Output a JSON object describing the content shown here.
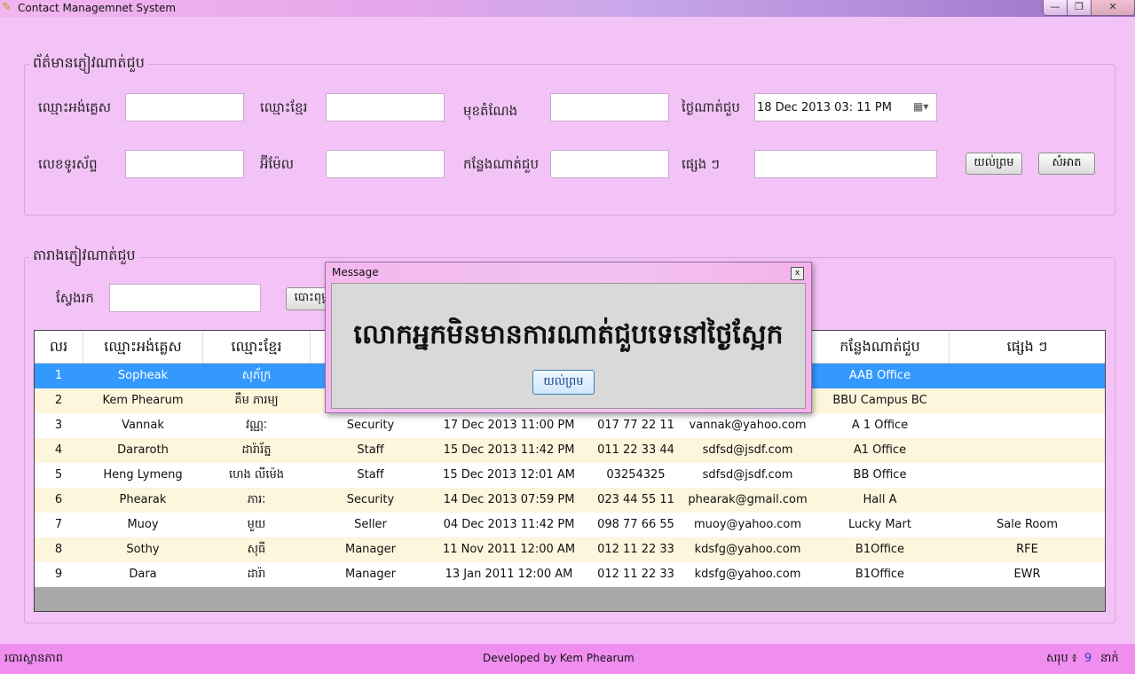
{
  "window": {
    "title": "Contact Managemnet System",
    "min": "—",
    "max": "❐",
    "close": "✕"
  },
  "info_group": {
    "legend": "ព័ត៌មានភ្ញៀវណាត់ជួប",
    "fields": {
      "english_name": {
        "label": "ឈ្មោះអង់គ្លេស",
        "value": ""
      },
      "khmer_name": {
        "label": "ឈ្មោះខ្មែរ",
        "value": ""
      },
      "position": {
        "label": "មុខតំណែង",
        "value": ""
      },
      "appointment_date": {
        "label": "ថ្ងៃណាត់ជួប",
        "value": "18 Dec 2013   03: 11 PM"
      },
      "phone": {
        "label": "លេខទូរស័ព្ទ",
        "value": ""
      },
      "email": {
        "label": "អ៊ីម៉ែល",
        "value": ""
      },
      "place": {
        "label": "កន្លែងណាត់ជួប",
        "value": ""
      },
      "other": {
        "label": "ផ្សេង ៗ",
        "value": ""
      }
    },
    "ok_button": "យល់ព្រម",
    "clear_button": "សំអាត"
  },
  "table_group": {
    "legend": "តារាងភ្ញៀវណាត់ជួប",
    "search_label": "ស្វែងរក",
    "search_value": "",
    "search_button": "បោះពុម្ព"
  },
  "grid": {
    "columns": [
      "លរ",
      "ឈ្មោះអង់គ្លេស",
      "ឈ្មោះខ្មែរ",
      "",
      "",
      "",
      "",
      "កន្លែងណាត់ជួប",
      "ផ្សេង ៗ"
    ],
    "rows": [
      [
        "1",
        "Sopheak",
        "សុភ័ក្រ",
        "",
        "",
        "",
        "",
        "AAB Office",
        ""
      ],
      [
        "2",
        "Kem Phearum",
        "គឹម ភារម្យ",
        "",
        "",
        "",
        "",
        "BBU Campus BC",
        ""
      ],
      [
        "3",
        "Vannak",
        "វណ្ណៈ",
        "Security",
        "17 Dec 2013   11:00 PM",
        "017 77 22 11",
        "vannak@yahoo.com",
        "A 1 Office",
        ""
      ],
      [
        "4",
        "Dararoth",
        "ដារ៉ារ័ត្ន",
        "Staff",
        "15 Dec 2013   11:42 PM",
        "011 22 33 44",
        "sdfsd@jsdf.com",
        "A1 Office",
        ""
      ],
      [
        "5",
        "Heng Lymeng",
        "ហេង លីម៉េង",
        "Staff",
        "15 Dec 2013   12:01 AM",
        "03254325",
        "sdfsd@jsdf.com",
        "BB Office",
        ""
      ],
      [
        "6",
        "Phearak",
        "ភារៈ",
        "Security",
        "14 Dec 2013   07:59 PM",
        "023 44 55 11",
        "phearak@gmail.com",
        "Hall A",
        ""
      ],
      [
        "7",
        "Muoy",
        "មួយ",
        "Seller",
        "04 Dec 2013   11:42 PM",
        "098 77 66 55",
        "muoy@yahoo.com",
        "Lucky Mart",
        "Sale Room"
      ],
      [
        "8",
        "Sothy",
        "សុធី",
        "Manager",
        "11 Nov 2011   12:00 AM",
        "012 11 22 33",
        "kdsfg@yahoo.com",
        "B1Office",
        "RFE"
      ],
      [
        "9",
        "Dara",
        "ដារ៉ា",
        "Manager",
        "13 Jan 2011   12:00 AM",
        "012 11 22 33",
        "kdsfg@yahoo.com",
        "B1Office",
        "EWR"
      ]
    ],
    "selected_row": 0
  },
  "status": {
    "left": "របារស្ថានភាព",
    "center": "Developed by Kem Phearum",
    "total_label": "សរុប ៖",
    "total_count": "9",
    "total_unit": "នាក់"
  },
  "dialog": {
    "title": "Message",
    "message": "លោកអ្នកមិនមានការណាត់ជួបទេនៅថ្ងៃស្អែក",
    "ok": "យល់ព្រម",
    "close": "x"
  },
  "colors": {
    "background": "#f3c3f7",
    "status_bar": "#f08ef0",
    "selected_row": "#3399ff",
    "alt_row": "#fdf5dc"
  }
}
